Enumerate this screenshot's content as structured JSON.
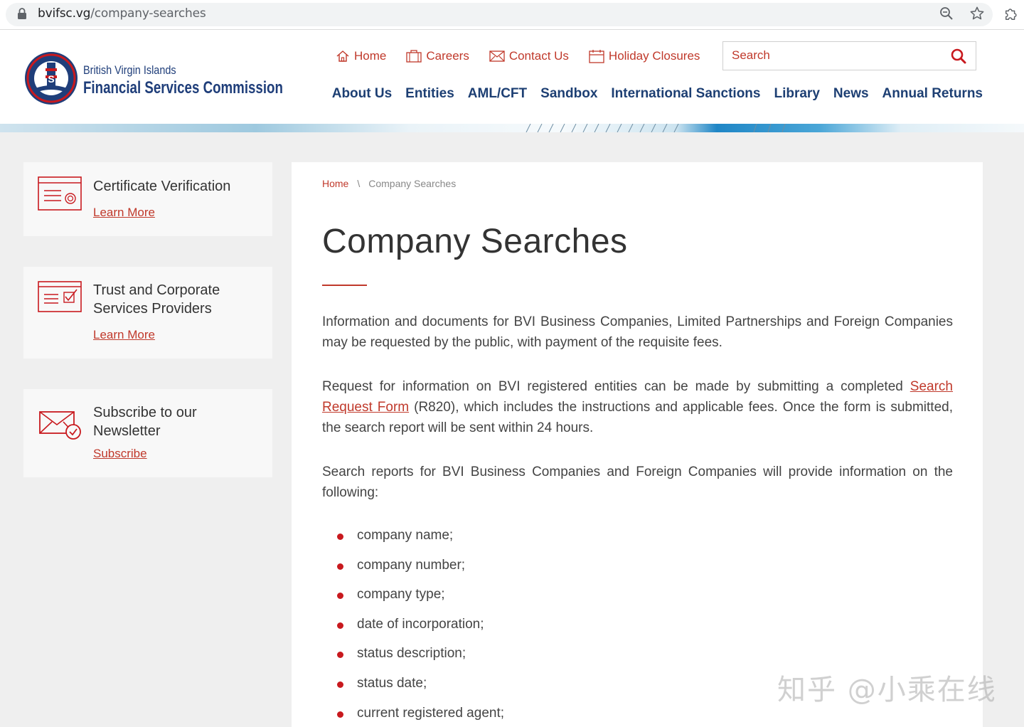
{
  "browser": {
    "url_domain": "bvifsc.vg",
    "url_path": "/company-searches"
  },
  "header": {
    "logo_line1": "British Virgin Islands",
    "logo_line2": "Financial Services Commission",
    "utility_nav": [
      {
        "label": "Home",
        "icon": "home-icon"
      },
      {
        "label": "Careers",
        "icon": "briefcase-icon"
      },
      {
        "label": "Contact Us",
        "icon": "envelope-icon"
      },
      {
        "label": "Holiday Closures",
        "icon": "calendar-icon"
      }
    ],
    "search_placeholder": "Search",
    "main_nav": [
      "About Us",
      "Entities",
      "AML/CFT",
      "Sandbox",
      "International Sanctions",
      "Library",
      "News",
      "Annual Returns"
    ]
  },
  "sidebar": {
    "cards": [
      {
        "title": "Certificate Verification",
        "link": "Learn More",
        "icon": "certificate-icon"
      },
      {
        "title": "Trust and Corporate Services Providers",
        "link": "Learn More",
        "icon": "checklist-icon"
      },
      {
        "title": "Subscribe to our Newsletter",
        "link": "Subscribe",
        "icon": "mail-check-icon"
      }
    ]
  },
  "content": {
    "breadcrumb": {
      "home": "Home",
      "separator": "\\",
      "current": "Company Searches"
    },
    "title": "Company Searches",
    "para1": "Information and documents for BVI Business Companies, Limited Partnerships and Foreign Companies may be requested by the public, with payment of the requisite fees.",
    "para2_before": "Request for information on BVI registered entities can be made by submitting a completed ",
    "para2_link": "Search Request Form",
    "para2_after": " (R820), which includes the instructions and applicable fees. Once the form is submitted, the search report will be sent within 24 hours.",
    "para3": "Search reports for BVI Business Companies and Foreign Companies will provide information on the following:",
    "bullets": [
      "company name;",
      "company number;",
      "company type;",
      "date of incorporation;",
      "status description;",
      "status date;",
      "current registered agent;"
    ]
  },
  "watermark": "知乎 @小乘在线",
  "colors": {
    "accent_red": "#c0392b",
    "nav_blue": "#1d3f73",
    "page_bg": "#efefef"
  }
}
